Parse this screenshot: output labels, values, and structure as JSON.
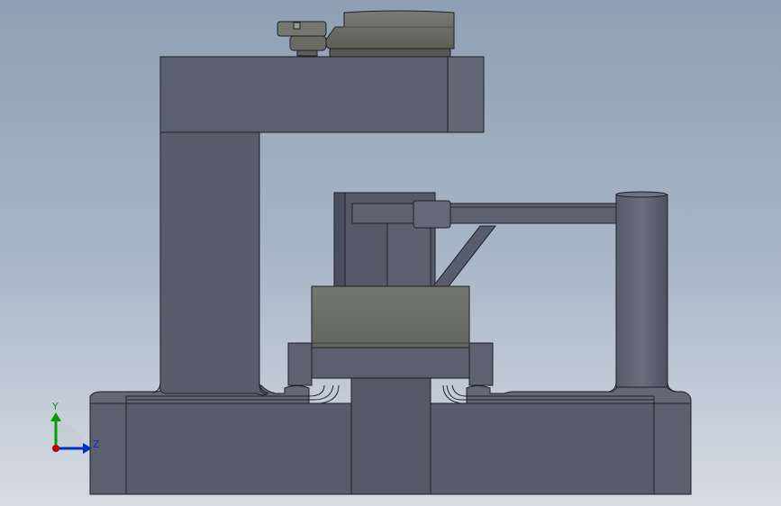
{
  "viewport": {
    "background_top": "#8fa0b5",
    "background_bottom": "#d6dce4"
  },
  "colors": {
    "body_dark": "#4a4f5e",
    "body_mid": "#5a5f6e",
    "body_light": "#6a6f7e",
    "edge": "#1e2128",
    "block_olive": "#6b6e66",
    "block_olive_top": "#5b5e56",
    "motor_body": "#6c6e66",
    "axis_x": "#c00000",
    "axis_y": "#00a000",
    "axis_z": "#0030c0"
  },
  "triad": {
    "y_label": "Y",
    "z_label": "Z"
  }
}
